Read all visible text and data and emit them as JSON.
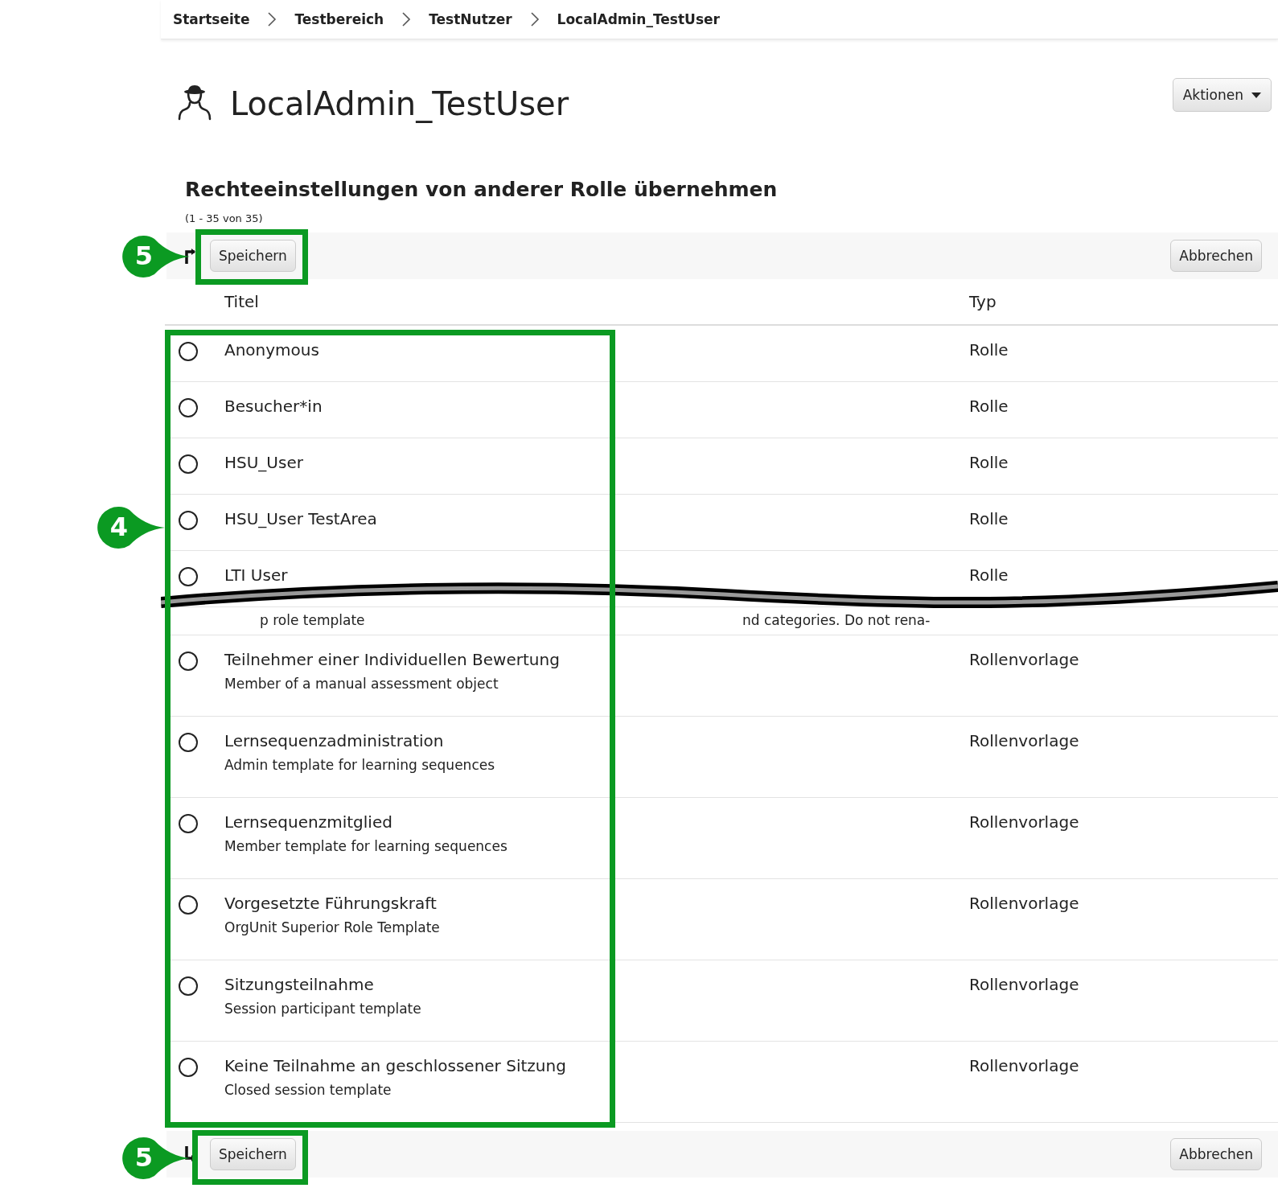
{
  "breadcrumb": [
    {
      "label": "Startseite"
    },
    {
      "label": "Testbereich"
    },
    {
      "label": "TestNutzer"
    },
    {
      "label": "LocalAdmin_TestUser"
    }
  ],
  "header": {
    "title": "LocalAdmin_TestUser",
    "actions_button": "Aktionen"
  },
  "section": {
    "title": "Rechteeinstellungen von anderer Rolle übernehmen",
    "count": "(1 - 35 von 35)"
  },
  "toolbar_top": {
    "save": "Speichern",
    "cancel": "Abbrechen"
  },
  "table": {
    "columns": [
      "Titel",
      "Typ"
    ],
    "rows": [
      {
        "title": "Anonymous",
        "type": "Rolle",
        "selected": false
      },
      {
        "title": "Besucher*in",
        "type": "Rolle",
        "selected": false
      },
      {
        "title": "HSU_User",
        "type": "Rolle",
        "selected": false
      },
      {
        "title": "HSU_User TestArea",
        "type": "Rolle",
        "selected": false
      },
      {
        "title": "LTI User",
        "type": "Rolle",
        "selected": false
      },
      {
        "kind": "break",
        "fragments": [
          "p role template",
          "nd categories. Do not rena-"
        ]
      },
      {
        "title": "Teilnehmer einer Individuellen Bewertung",
        "description": "Member of a manual assessment object",
        "type": "Rollenvorlage",
        "selected": false
      },
      {
        "title": "Lernsequenzadministration",
        "description": "Admin template for learning sequences",
        "type": "Rollenvorlage",
        "selected": false
      },
      {
        "title": "Lernsequenzmitglied",
        "description": "Member template for learning sequences",
        "type": "Rollenvorlage",
        "selected": false
      },
      {
        "title": "Vorgesetzte Führungskraft",
        "description": "OrgUnit Superior Role Template",
        "type": "Rollenvorlage",
        "selected": false
      },
      {
        "title": "Sitzungsteilnahme",
        "description": "Session participant template",
        "type": "Rollenvorlage",
        "selected": false
      },
      {
        "title": "Keine Teilnahme an geschlossener Sitzung",
        "description": "Closed session template",
        "type": "Rollenvorlage",
        "selected": false
      }
    ]
  },
  "toolbar_bottom": {
    "save": "Speichern",
    "cancel": "Abbrechen"
  },
  "annotations": {
    "top_save": {
      "label": "5"
    },
    "role_list": {
      "label": "4"
    },
    "bottom_save": {
      "label": "5"
    }
  }
}
